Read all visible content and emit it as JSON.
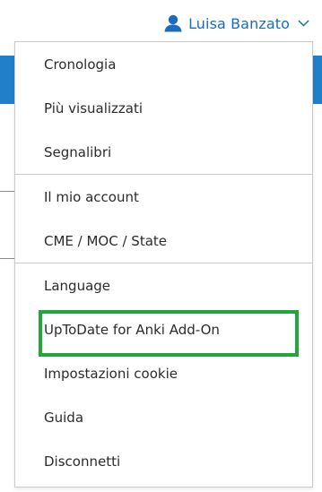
{
  "header": {
    "user_name": "Luisa Banzato",
    "user_icon": "user-icon",
    "chevron_icon": "chevron-down-icon",
    "accent_color": "#1a6cc0"
  },
  "menu": {
    "groups": [
      {
        "items": [
          {
            "label": "Cronologia"
          },
          {
            "label": "Più visualizzati"
          },
          {
            "label": "Segnalibri"
          }
        ]
      },
      {
        "items": [
          {
            "label": "Il mio account"
          },
          {
            "label": "CME / MOC / State"
          }
        ]
      },
      {
        "items": [
          {
            "label": "Language"
          },
          {
            "label": "UpToDate for Anki Add-On",
            "highlighted": true
          },
          {
            "label": "Impostazioni cookie"
          },
          {
            "label": "Guida"
          },
          {
            "label": "Disconnetti"
          }
        ]
      }
    ],
    "highlight_color": "#22a83a"
  }
}
